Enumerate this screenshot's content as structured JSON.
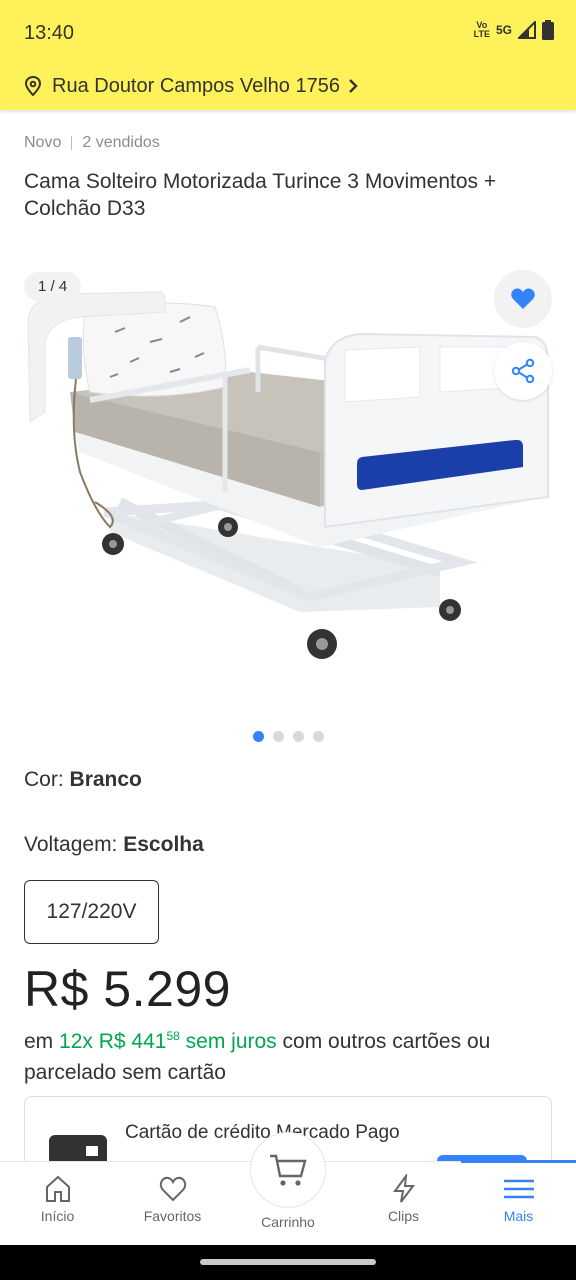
{
  "status_bar": {
    "time": "13:40",
    "volte_label": "Vo LTE",
    "network_label": "5G"
  },
  "address": {
    "text": "Rua Doutor Campos Velho 1756"
  },
  "product": {
    "condition": "Novo",
    "sold": "2 vendidos",
    "title": "Cama Solteiro Motorizada Turince 3 Movimentos + Colchão D33"
  },
  "gallery": {
    "counter": "1 / 4",
    "current_index": 1,
    "total": 4
  },
  "variants": {
    "color_label": "Cor:",
    "color_value": "Branco",
    "voltage_label": "Voltagem:",
    "voltage_value": "Escolha",
    "voltage_option": "127/220V"
  },
  "price": {
    "main": "R$ 5.299",
    "install_prefix": "em",
    "install_count": "12x",
    "install_value": "R$ 441",
    "install_cents": "58",
    "install_interest": "sem juros",
    "install_suffix": "com outros cartões ou parcelado sem cartão"
  },
  "payment_card": {
    "title": "Cartão de crédito Mercado Pago"
  },
  "bottom_nav": {
    "items": [
      {
        "label": "Início",
        "icon": "home-icon"
      },
      {
        "label": "Favoritos",
        "icon": "heart-outline-icon"
      },
      {
        "label": "Carrinho",
        "icon": "cart-icon"
      },
      {
        "label": "Clips",
        "icon": "lightning-icon"
      },
      {
        "label": "Mais",
        "icon": "menu-icon"
      }
    ],
    "active": "Mais"
  },
  "colors": {
    "brand_yellow": "#fff159",
    "accent_blue": "#3483fa",
    "green": "#00a650"
  }
}
